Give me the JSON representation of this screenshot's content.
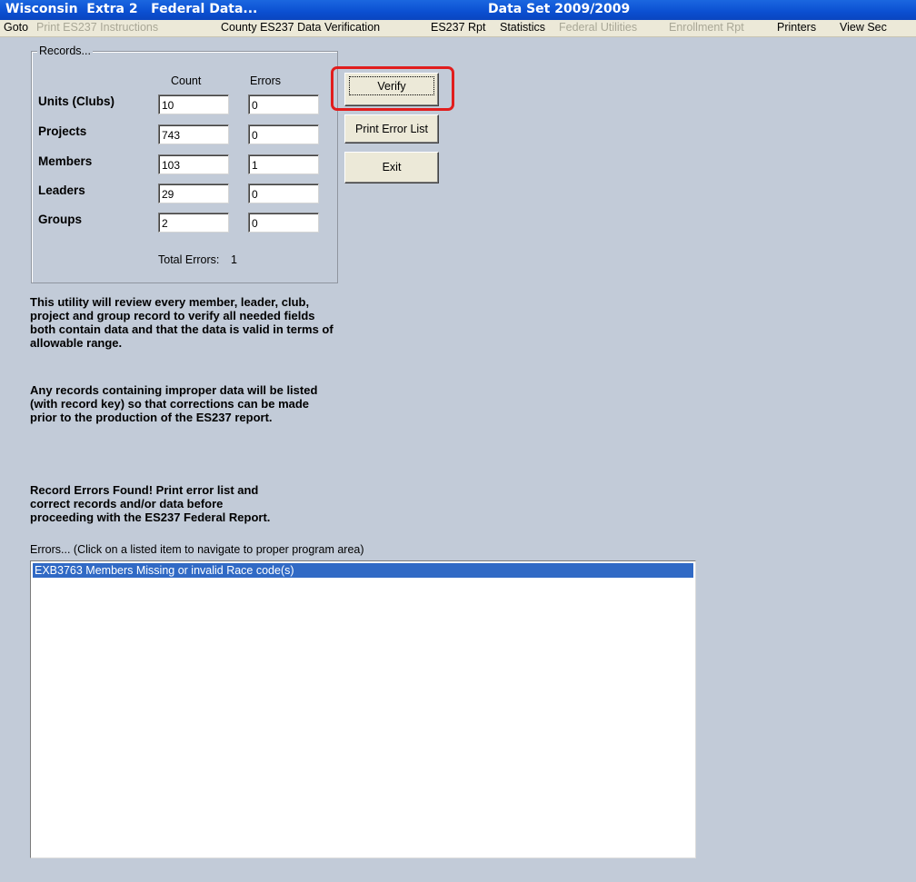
{
  "titlebar": {
    "left": "Wisconsin  Extra 2   Federal Data...",
    "center": "Data Set 2009/2009"
  },
  "menubar": {
    "items": [
      {
        "label": "Goto",
        "enabled": true
      },
      {
        "label": "Print ES237 Instructions",
        "enabled": false
      },
      {
        "label": "County ES237 Data Verification",
        "enabled": true
      },
      {
        "label": "ES237 Rpt",
        "enabled": true
      },
      {
        "label": "Statistics",
        "enabled": true
      },
      {
        "label": "Federal Utilities",
        "enabled": false
      },
      {
        "label": "Enrollment Rpt",
        "enabled": false
      },
      {
        "label": "Printers",
        "enabled": true
      },
      {
        "label": "View Sec",
        "enabled": true
      }
    ]
  },
  "records": {
    "legend": "Records...",
    "count_header": "Count",
    "errors_header": "Errors",
    "rows": [
      {
        "label": "Units (Clubs)",
        "count": "10",
        "errors": "0"
      },
      {
        "label": "Projects",
        "count": "743",
        "errors": "0"
      },
      {
        "label": "Members",
        "count": "103",
        "errors": "1"
      },
      {
        "label": "Leaders",
        "count": "29",
        "errors": "0"
      },
      {
        "label": "Groups",
        "count": "2",
        "errors": "0"
      }
    ],
    "total_errors_label": "Total Errors:",
    "total_errors_value": "1"
  },
  "buttons": {
    "verify": "Verify",
    "print_error_list": "Print Error List",
    "exit": "Exit"
  },
  "description": {
    "paragraph1": "This utility will review every member, leader, club,\nproject and group record to verify all needed fields\nboth contain data and that the data is valid in terms of\nallowable range.",
    "paragraph2": "Any records containing improper data will be listed\n(with record key) so that corrections can be made\nprior to the production of the ES237 report.",
    "status": "Record Errors Found!  Print error list and\ncorrect records and/or data before\nproceeding with the ES237 Federal Report."
  },
  "errors_list": {
    "caption": "Errors...  (Click on a listed item to navigate to proper program area)",
    "items": [
      "EXB3763 Members Missing or invalid Race code(s)"
    ]
  },
  "colors": {
    "background": "#c2cbd8",
    "titlebar": "#0b4fd1",
    "highlight": "#e11d1d",
    "selection": "#316ac5"
  }
}
